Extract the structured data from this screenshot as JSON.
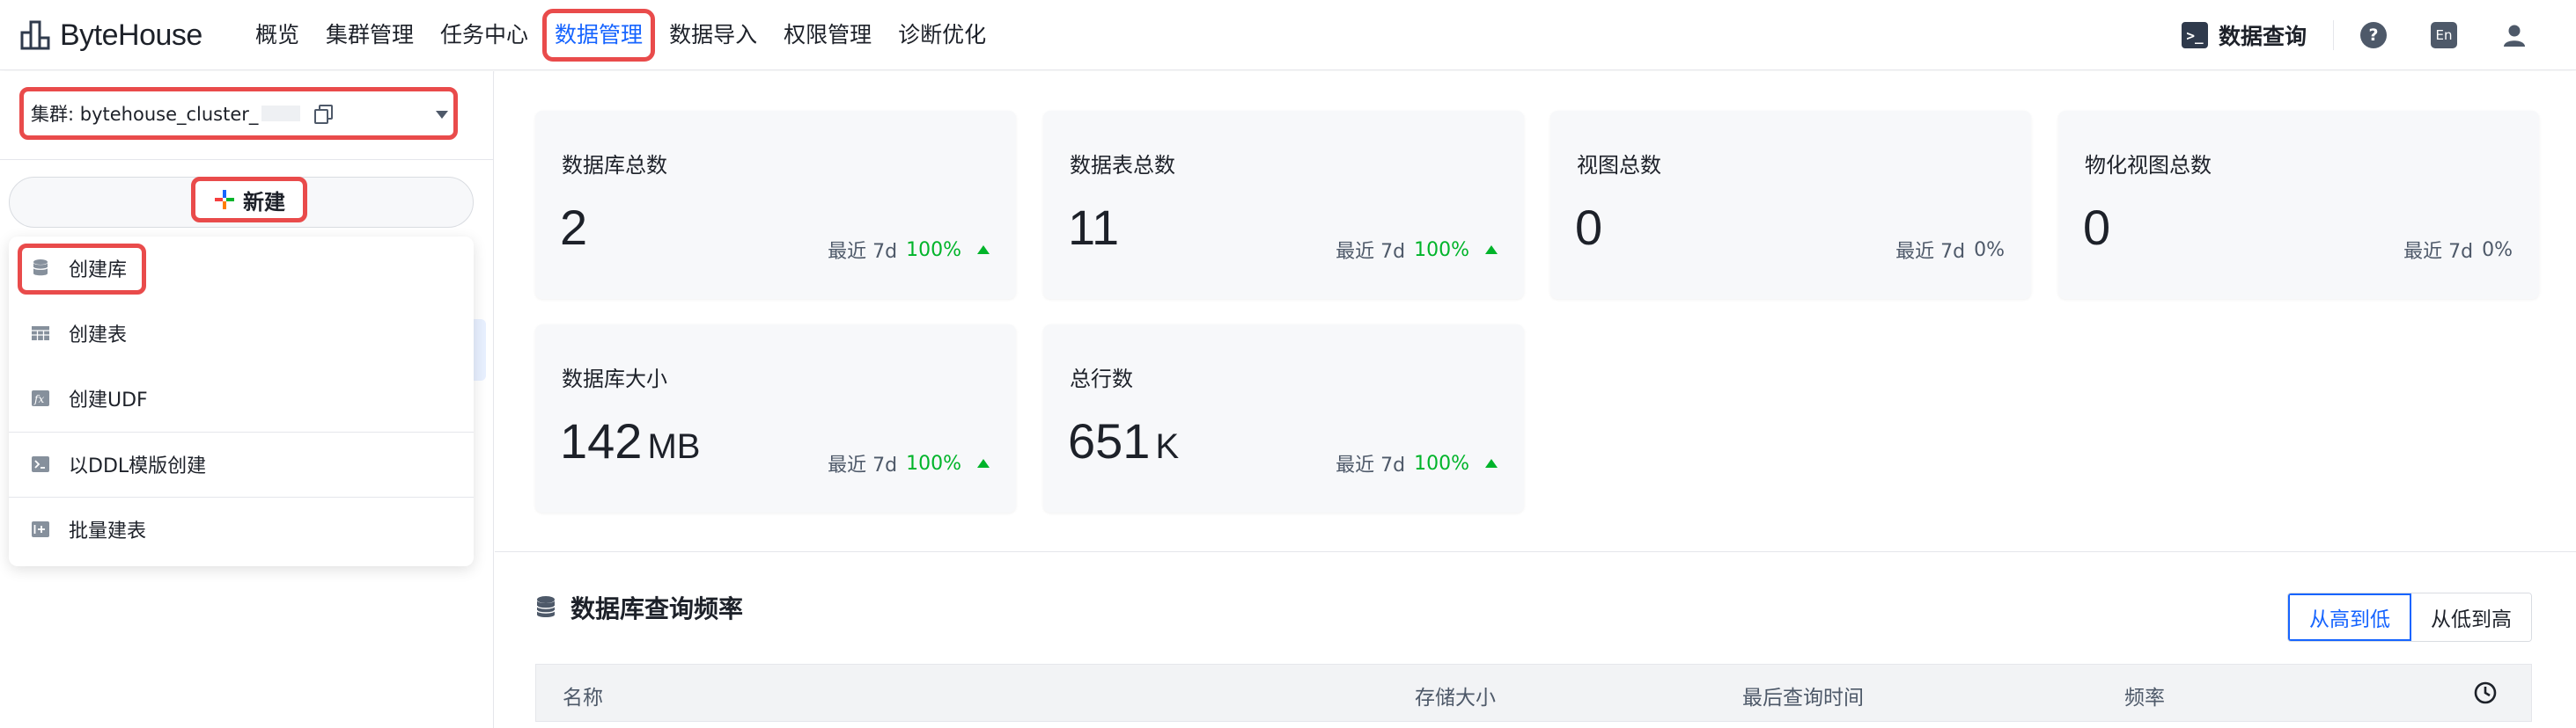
{
  "brand": {
    "name": "ByteHouse"
  },
  "nav": {
    "items": [
      "概览",
      "集群管理",
      "任务中心",
      "数据管理",
      "数据导入",
      "权限管理",
      "诊断优化"
    ],
    "active_index": 3,
    "query_label": "数据查询",
    "help_glyph": "?",
    "lang_glyph": "En"
  },
  "sidebar": {
    "cluster_label": "集群: bytehouse_cluster_",
    "new_label": "新建",
    "dropdown": [
      {
        "label": "创建库",
        "icon": "database-icon"
      },
      {
        "label": "创建表",
        "icon": "table-icon"
      },
      {
        "label": "创建UDF",
        "icon": "function-icon"
      },
      {
        "label": "以DDL模版创建",
        "icon": "terminal-icon"
      },
      {
        "label": "批量建表",
        "icon": "batch-add-icon"
      }
    ]
  },
  "stats": [
    {
      "title": "数据库总数",
      "value": "2",
      "unit": "",
      "period": "最近 7d",
      "pct": "100%",
      "up": true
    },
    {
      "title": "数据表总数",
      "value": "11",
      "unit": "",
      "period": "最近 7d",
      "pct": "100%",
      "up": true
    },
    {
      "title": "视图总数",
      "value": "0",
      "unit": "",
      "period": "最近 7d",
      "pct": "0%",
      "up": false
    },
    {
      "title": "物化视图总数",
      "value": "0",
      "unit": "",
      "period": "最近 7d",
      "pct": "0%",
      "up": false
    },
    {
      "title": "数据库大小",
      "value": "142",
      "unit": "MB",
      "period": "最近 7d",
      "pct": "100%",
      "up": true
    },
    {
      "title": "总行数",
      "value": "651",
      "unit": "K",
      "period": "最近 7d",
      "pct": "100%",
      "up": true
    }
  ],
  "query_freq": {
    "title": "数据库查询频率",
    "sort_desc": "从高到低",
    "sort_asc": "从低到高",
    "columns": [
      "名称",
      "存储大小",
      "最后查询时间",
      "频率"
    ]
  },
  "colors": {
    "accent": "#1664ff",
    "up": "#00b42a",
    "highlight_box": "#e94b4b"
  }
}
